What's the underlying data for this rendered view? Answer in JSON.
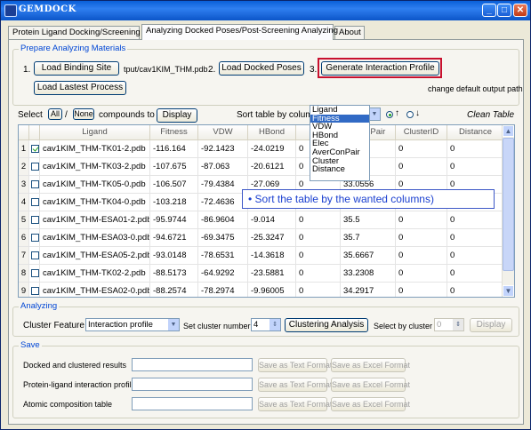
{
  "window": {
    "title": "GEMDOCK"
  },
  "tabs": [
    {
      "label": "Protein Ligand Docking/Screening"
    },
    {
      "label": "Analyzing Docked Poses/Post-Screening Analyzing"
    },
    {
      "label": "About"
    }
  ],
  "prepare": {
    "group_label": "Prepare Analyzing Materials",
    "step1": "1.",
    "load_binding_site": "Load Binding Site",
    "binding_site_path": "tput/cav1KIM_THM.pdb",
    "step2": "2.",
    "load_docked_poses": "Load Docked Poses",
    "step3": "3.",
    "generate_profile": "Generate Interaction Profile",
    "load_lastest": "Load Lastest Process",
    "change_output": "change default output path"
  },
  "selection": {
    "select_label": "Select",
    "all": "All",
    "slash": "/",
    "none": "None",
    "compounds_to": "compounds to",
    "display": "Display",
    "sort_label": "Sort table by colum",
    "clean": "Clean Table",
    "sort_options": [
      "Ligand",
      "Fitness",
      "VDW",
      "HBond",
      "Elec",
      "AverConPair",
      "Cluster",
      "Distance"
    ],
    "selected_sort": "Fitness"
  },
  "table": {
    "columns": [
      "",
      "Ligand",
      "Fitness",
      "VDW",
      "HBond",
      "Elec",
      "AverConPair",
      "ClusterID",
      "Distance"
    ],
    "column_headers_visible": [
      "Ligand",
      "Fitness",
      "VDW",
      "HBond",
      "eConPair",
      "ClusterID",
      "Distance"
    ],
    "rows": [
      {
        "n": "1",
        "checked": true,
        "ligand": "cav1KIM_THM-TK01-2.pdb",
        "fitness": "-116.164",
        "vdw": "-92.1423",
        "hbond": "-24.0219",
        "elec": "0",
        "acp": "56",
        "cluster": "0",
        "dist": "0"
      },
      {
        "n": "2",
        "checked": false,
        "ligand": "cav1KIM_THM-TK03-2.pdb",
        "fitness": "-107.675",
        "vdw": "-87.063",
        "hbond": "-20.6121",
        "elec": "0",
        "acp": "43",
        "cluster": "0",
        "dist": "0"
      },
      {
        "n": "3",
        "checked": false,
        "ligand": "cav1KIM_THM-TK05-0.pdb",
        "fitness": "-106.507",
        "vdw": "-79.4384",
        "hbond": "-27.069",
        "elec": "0",
        "acp": "33.0556",
        "cluster": "0",
        "dist": "0"
      },
      {
        "n": "4",
        "checked": false,
        "ligand": "cav1KIM_THM-TK04-0.pdb",
        "fitness": "-103.218",
        "vdw": "-72.4636",
        "hbond": "",
        "elec": "",
        "acp": "",
        "cluster": "",
        "dist": ""
      },
      {
        "n": "5",
        "checked": false,
        "ligand": "cav1KIM_THM-ESA01-2.pdb",
        "fitness": "-95.9744",
        "vdw": "-86.9604",
        "hbond": "-9.014",
        "elec": "0",
        "acp": "35.5",
        "cluster": "0",
        "dist": "0"
      },
      {
        "n": "6",
        "checked": false,
        "ligand": "cav1KIM_THM-ESA03-0.pdb",
        "fitness": "-94.6721",
        "vdw": "-69.3475",
        "hbond": "-25.3247",
        "elec": "0",
        "acp": "35.7",
        "cluster": "0",
        "dist": "0"
      },
      {
        "n": "7",
        "checked": false,
        "ligand": "cav1KIM_THM-ESA05-2.pdb",
        "fitness": "-93.0148",
        "vdw": "-78.6531",
        "hbond": "-14.3618",
        "elec": "0",
        "acp": "35.6667",
        "cluster": "0",
        "dist": "0"
      },
      {
        "n": "8",
        "checked": false,
        "ligand": "cav1KIM_THM-TK02-2.pdb",
        "fitness": "-88.5173",
        "vdw": "-64.9292",
        "hbond": "-23.5881",
        "elec": "0",
        "acp": "33.2308",
        "cluster": "0",
        "dist": "0"
      },
      {
        "n": "9",
        "checked": false,
        "ligand": "cav1KIM_THM-ESA02-0.pdb",
        "fitness": "-88.2574",
        "vdw": "-78.2974",
        "hbond": "-9.96005",
        "elec": "0",
        "acp": "34.2917",
        "cluster": "0",
        "dist": "0"
      }
    ]
  },
  "annotation": "• Sort the table by the wanted columns)",
  "analyzing": {
    "group_label": "Analyzing",
    "cluster_feature": "Cluster Feature",
    "feature_value": "Interaction profile",
    "set_cluster_number": "Set cluster number",
    "cluster_number": "4",
    "clustering_analysis": "Clustering Analysis",
    "select_by_cluster": "Select by cluster",
    "cluster_select_value": "0",
    "display": "Display"
  },
  "save": {
    "group_label": "Save",
    "rows": [
      {
        "label": "Docked and clustered results",
        "text": "Save as Text Format",
        "excel": "Save as Excel Format"
      },
      {
        "label": "Protein-ligand interaction profile",
        "text": "Save as Text Format",
        "excel": "Save as Excel Format"
      },
      {
        "label": "Atomic composition table",
        "text": "Save as Text Format",
        "excel": "Save as Excel Format"
      }
    ]
  },
  "colors": {
    "accent_red": "#c8102e",
    "group_label_blue": "#0046d5",
    "selection_blue": "#316ac5"
  }
}
